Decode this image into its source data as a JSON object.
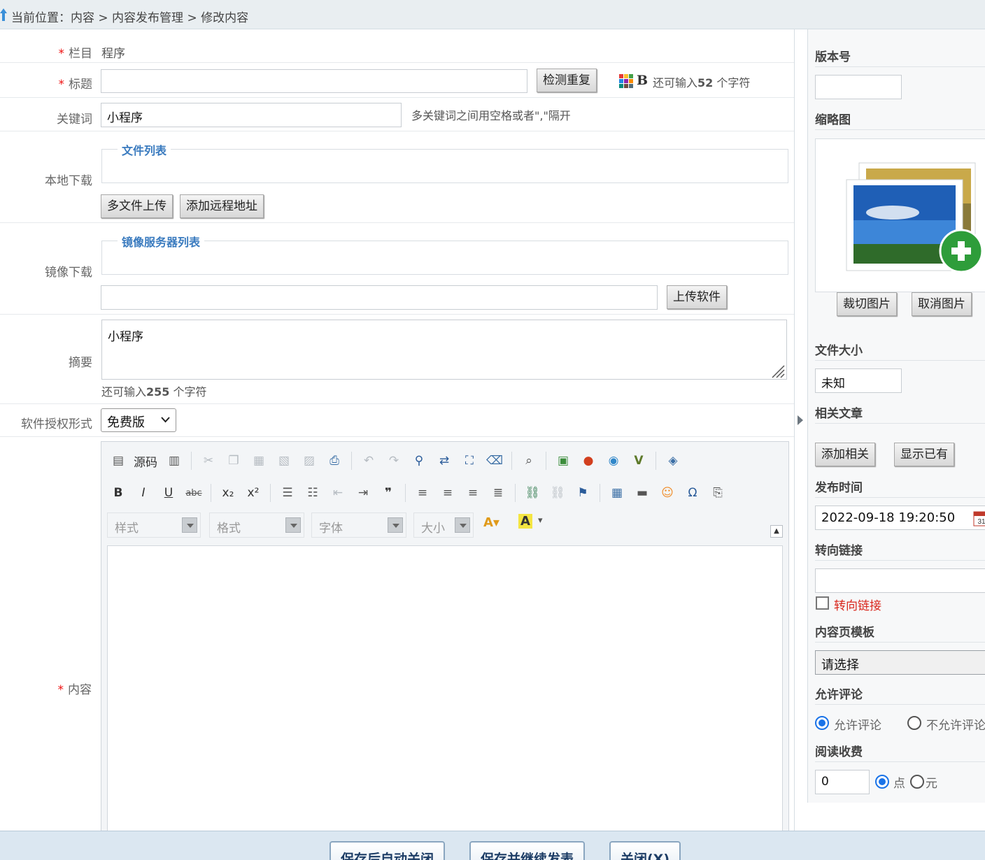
{
  "breadcrumb": {
    "prefix": "当前位置：",
    "path": "内容 > 内容发布管理 > 修改内容"
  },
  "form": {
    "category": {
      "label": "栏目",
      "value": "程序"
    },
    "title": {
      "label": "标题",
      "check_button": "检测重复",
      "bold_glyph": "B",
      "remaining_prefix": "还可输入",
      "remaining_count": "52",
      "remaining_suffix": " 个字符"
    },
    "keywords": {
      "label": "关键词",
      "value": "小程序",
      "hint": "多关键词之间用空格或者\",\"隔开"
    },
    "local_download": {
      "label": "本地下载",
      "legend": "文件列表",
      "multi_upload": "多文件上传",
      "add_remote": "添加远程地址"
    },
    "mirror_download": {
      "label": "镜像下载",
      "legend": "镜像服务器列表",
      "upload_software": "上传软件"
    },
    "summary": {
      "label": "摘要",
      "value": "小程序",
      "remaining_prefix": "还可输入",
      "remaining_count": "255",
      "remaining_suffix": " 个字符"
    },
    "license": {
      "label": "软件授权形式",
      "selected": "免费版"
    },
    "content": {
      "label": "内容",
      "source_label": "源码",
      "style_combo": "样式",
      "format_combo": "格式",
      "font_combo": "字体",
      "size_combo": "大小"
    }
  },
  "side": {
    "version": {
      "label": "版本号",
      "value": ""
    },
    "thumbnail": {
      "label": "缩略图",
      "crop": "裁切图片",
      "cancel": "取消图片"
    },
    "file_size": {
      "label": "文件大小",
      "value": "未知"
    },
    "related": {
      "label": "相关文章",
      "add": "添加相关",
      "show": "显示已有"
    },
    "publish_time": {
      "label": "发布时间",
      "value": "2022-09-18 19:20:50"
    },
    "redirect": {
      "label": "转向链接",
      "value": "",
      "checkbox_label": "转向链接"
    },
    "template": {
      "label": "内容页模板",
      "selected": "请选择"
    },
    "comment": {
      "label": "允许评论",
      "allow": "允许评论",
      "deny": "不允许评论"
    },
    "read_fee": {
      "label": "阅读收费",
      "value": "0",
      "unit_points": "点",
      "unit_yuan": "元"
    }
  },
  "footer": {
    "save_close": "保存后自动关闭",
    "save_continue": "保存并继续发表",
    "close": "关闭(X)"
  },
  "colors": {
    "required": "#ee1111",
    "legend": "#3a7bbf",
    "radio_on": "#1a73e8",
    "footer_bg": "#dbe7f1"
  }
}
